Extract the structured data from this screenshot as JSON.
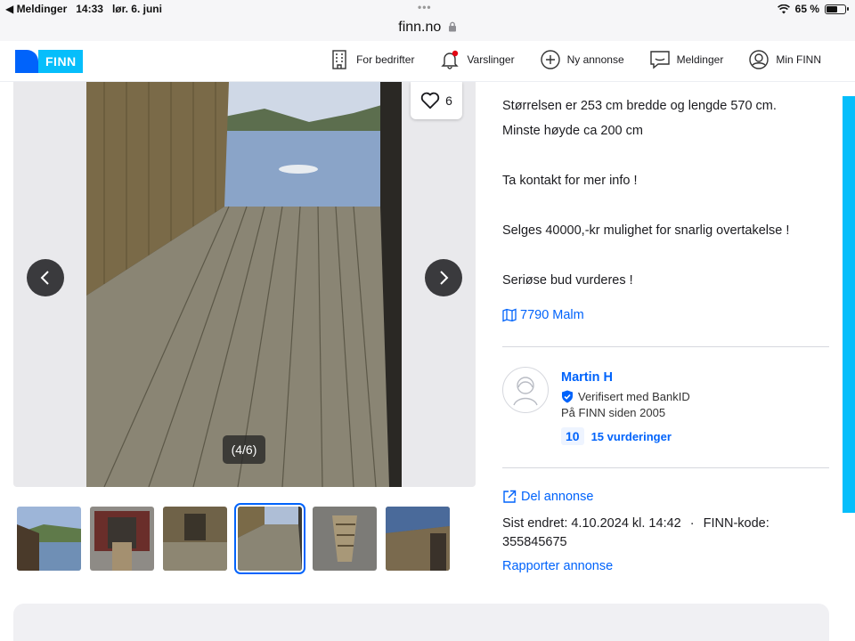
{
  "status": {
    "back_label": "◀ Meldinger",
    "time": "14:33",
    "date": "lør. 6. juni",
    "battery": "65 %",
    "battery_level": 0.65
  },
  "browser": {
    "url": "finn.no"
  },
  "header": {
    "logo_text": "FINN",
    "nav": [
      {
        "label": "For bedrifter",
        "icon": "building-icon"
      },
      {
        "label": "Varslinger",
        "icon": "bell-icon"
      },
      {
        "label": "Ny annonse",
        "icon": "plus-circle-icon"
      },
      {
        "label": "Meldinger",
        "icon": "chat-icon"
      },
      {
        "label": "Min FINN",
        "icon": "user-circle-icon"
      }
    ]
  },
  "gallery": {
    "favorite_count": "6",
    "counter": "(4/6)",
    "thumbnail_count": 6,
    "selected_thumbnail": 4
  },
  "description": {
    "lines": [
      "Størrelsen er 253 cm bredde og lengde 570 cm.",
      "Minste høyde ca 200 cm",
      "",
      "Ta kontakt for mer info !",
      "",
      "Selges 40000,-kr mulighet for snarlig overtakelse !",
      "",
      "Seriøse bud vurderes !"
    ]
  },
  "location": {
    "label": "7790 Malm"
  },
  "seller": {
    "name": "Martin H",
    "verified": "Verifisert med BankID",
    "member_since": "På FINN siden 2005",
    "score": "10",
    "reviews": "15 vurderinger"
  },
  "ad_actions": {
    "share": "Del annonse",
    "last_modified": "Sist endret: 4.10.2024 kl. 14:42",
    "separator": "·",
    "finn_code": "FINN-kode: 355845675",
    "report": "Rapporter annonse"
  },
  "colors": {
    "brand_blue": "#0063fb",
    "brand_light": "#06befb",
    "text": "#1b1b1f"
  }
}
